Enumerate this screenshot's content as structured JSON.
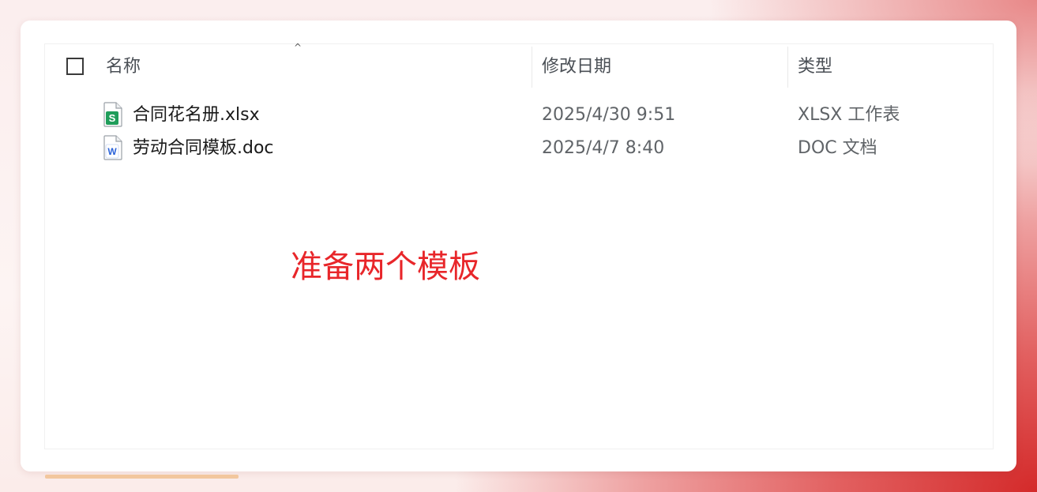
{
  "columns": {
    "name": "名称",
    "modified": "修改日期",
    "type": "类型"
  },
  "files": [
    {
      "name": "合同花名册.xlsx",
      "modified": "2025/4/30 9:51",
      "type": "XLSX 工作表",
      "icon": "xlsx-file-icon",
      "badge": "S",
      "badge_color": "#1f9d5a"
    },
    {
      "name": "劳动合同模板.doc",
      "modified": "2025/4/7 8:40",
      "type": "DOC 文档",
      "icon": "doc-file-icon",
      "badge": "W",
      "badge_color": "#2b63d9"
    }
  ],
  "annotation": "准备两个模板",
  "colors": {
    "annotation": "#e8262a",
    "background_accent": "#d42a2a",
    "progress": "#f2c79e"
  },
  "sort_indicator": "^",
  "progress_fraction": 1
}
